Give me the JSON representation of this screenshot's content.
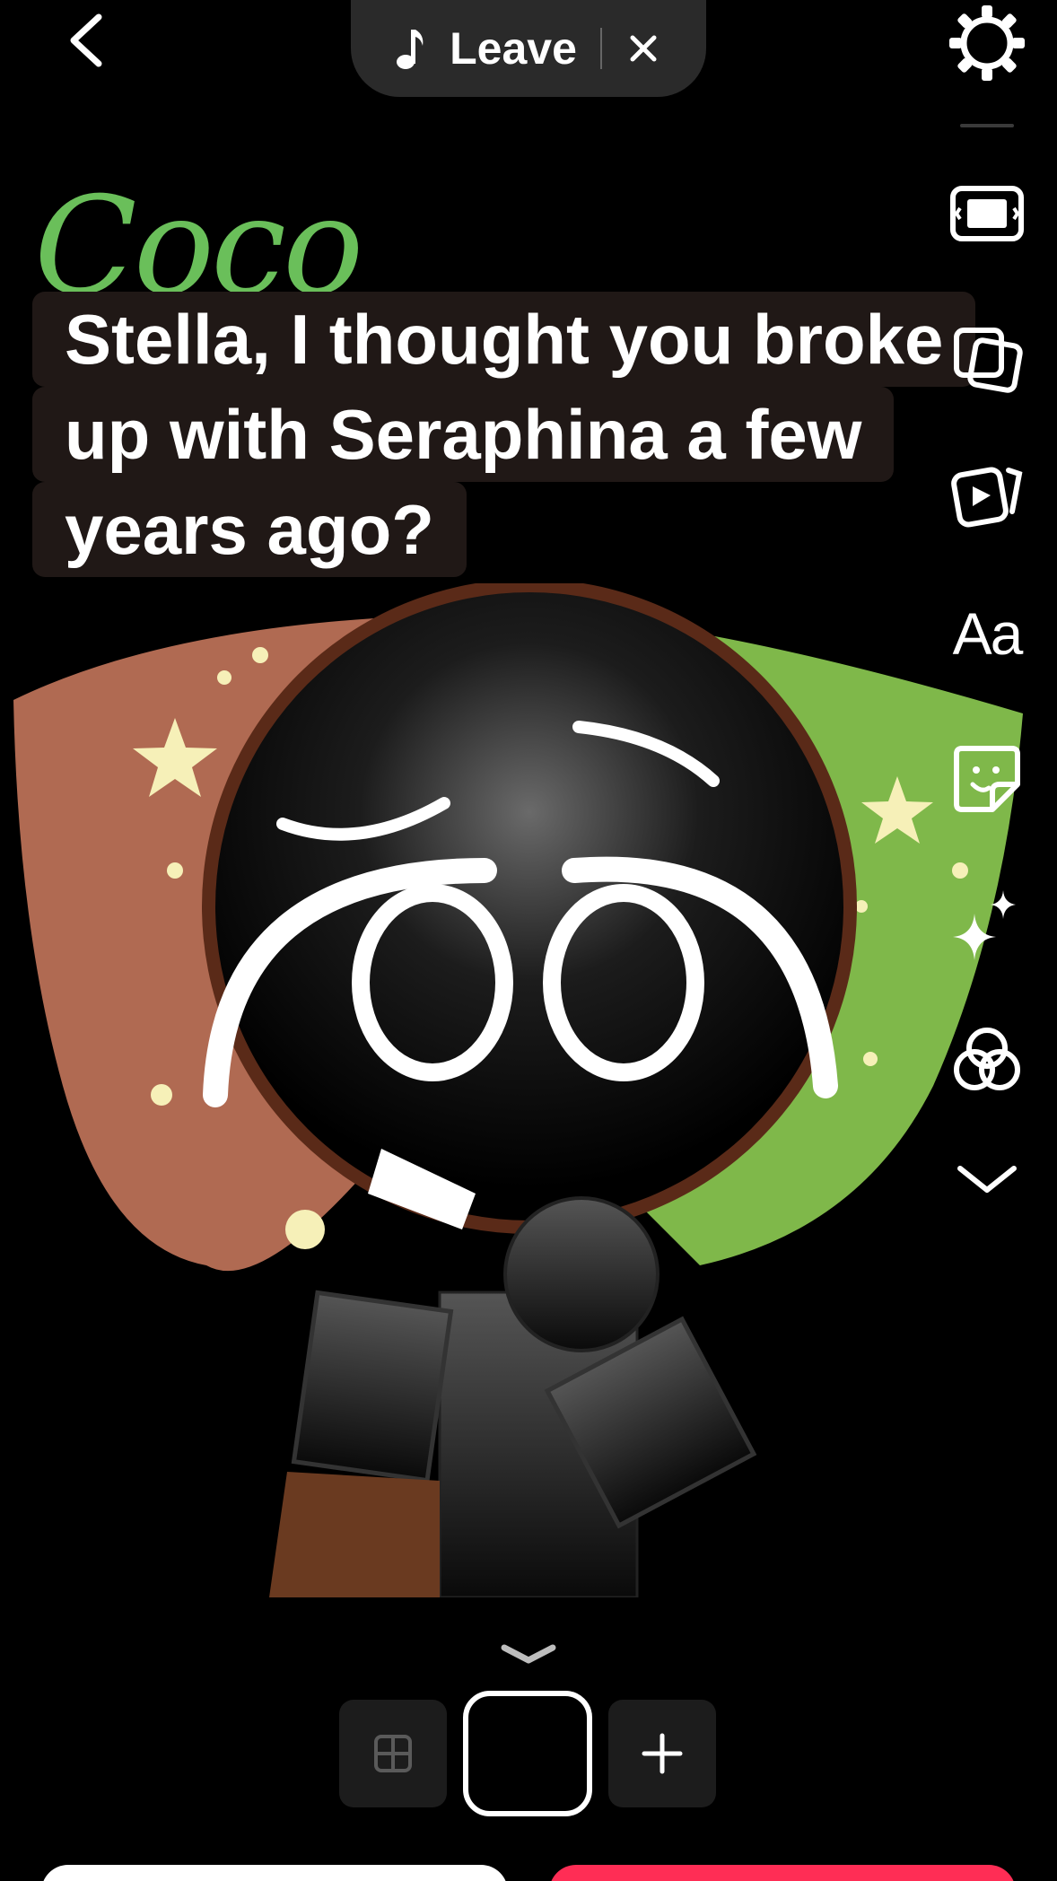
{
  "music": {
    "song_title": "Leave"
  },
  "character": {
    "name": "Coco"
  },
  "caption": {
    "lines": [
      "Stella, I thought you broke",
      "up with Seraphina a few",
      "years ago?"
    ]
  },
  "rail": {
    "text_tool_label": "Aa",
    "icons": [
      "aspect-ratio-icon",
      "photos-icon",
      "video-icon",
      "text-icon",
      "sticker-icon",
      "sparkles-icon",
      "filters-icon",
      "chevron-down-icon"
    ]
  },
  "colors": {
    "name_green": "#6abf5a",
    "caption_bg": "#201816",
    "pill_bg": "#2a2a2a",
    "accent_red": "#ff2d55",
    "background": "#000000"
  }
}
